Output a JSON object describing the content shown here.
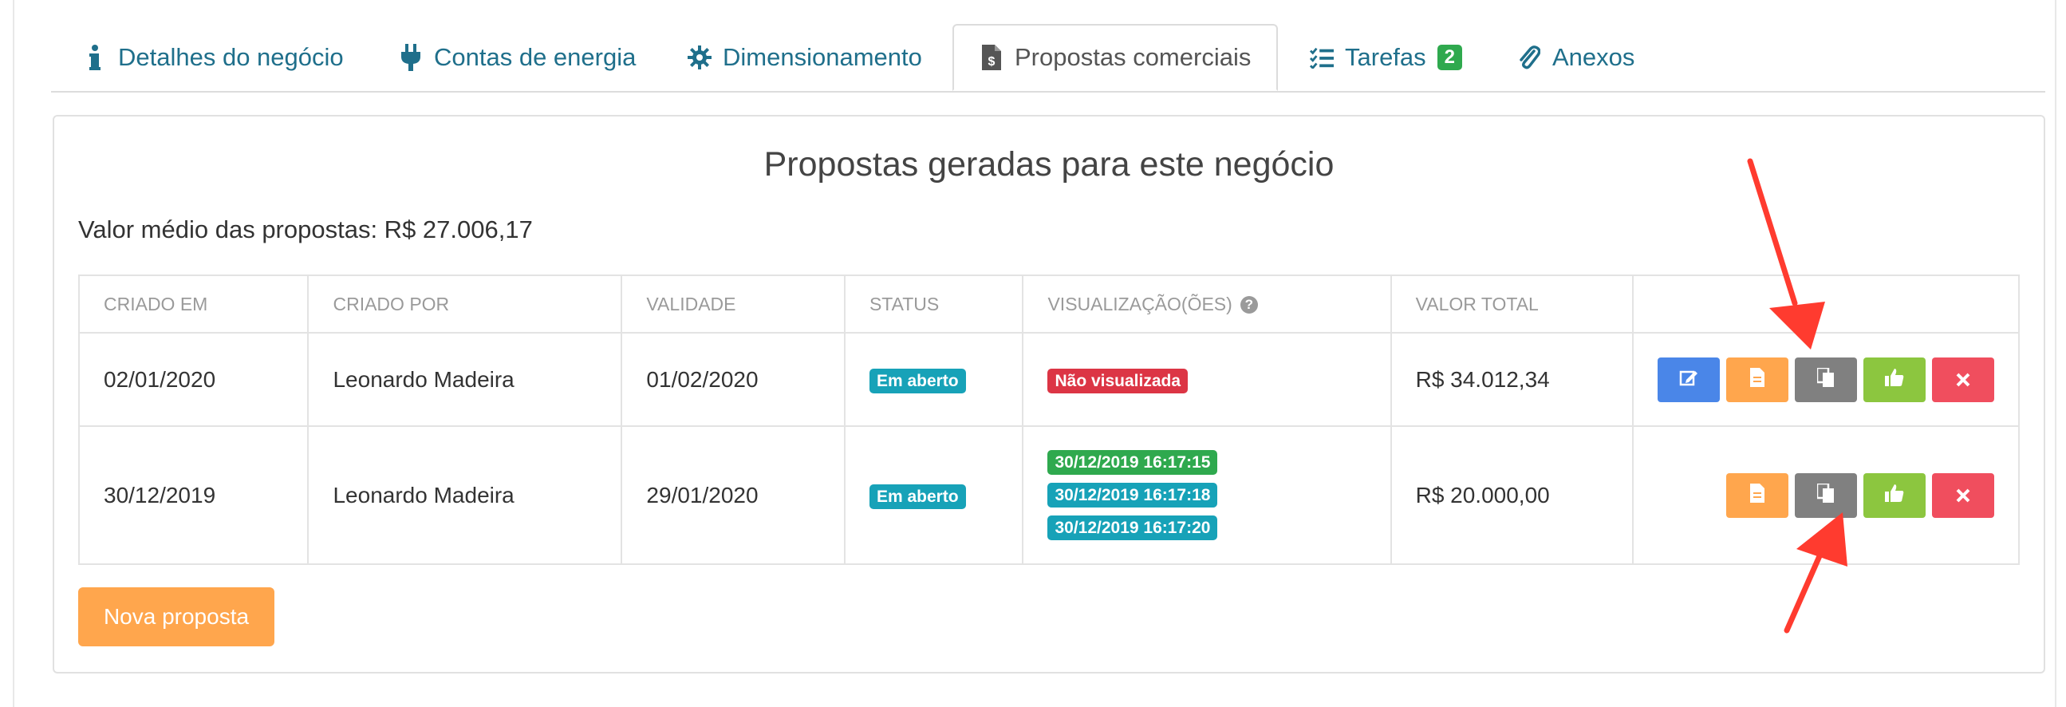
{
  "tabs": [
    {
      "label": "Detalhes do negócio",
      "icon": "info-icon"
    },
    {
      "label": "Contas de energia",
      "icon": "plug-icon"
    },
    {
      "label": "Dimensionamento",
      "icon": "gear-icon"
    },
    {
      "label": "Propostas comerciais",
      "icon": "invoice-icon",
      "active": true
    },
    {
      "label": "Tarefas",
      "icon": "task-list-icon",
      "badge": "2"
    },
    {
      "label": "Anexos",
      "icon": "paperclip-icon"
    }
  ],
  "panel": {
    "title": "Propostas geradas para este negócio",
    "average": "Valor médio das propostas: R$ 27.006,17"
  },
  "table": {
    "headers": [
      "CRIADO EM",
      "CRIADO POR",
      "VALIDADE",
      "STATUS",
      "VISUALIZAÇÃO(ÕES)",
      "VALOR TOTAL"
    ],
    "rows": [
      {
        "created": "02/01/2020",
        "author": "Leonardo Madeira",
        "validity": "01/02/2020",
        "status": "Em aberto",
        "views": [
          "Não visualizada"
        ],
        "total": "R$ 34.012,34"
      },
      {
        "created": "30/12/2019",
        "author": "Leonardo Madeira",
        "validity": "29/01/2020",
        "status": "Em aberto",
        "views": [
          "30/12/2019 16:17:15",
          "30/12/2019 16:17:18",
          "30/12/2019 16:17:20"
        ],
        "total": "R$ 20.000,00"
      }
    ]
  },
  "new_button": "Nova proposta",
  "colors": {
    "tab_text": "#1f6f8b",
    "edit": "#4a86e8",
    "document": "#ffa64d",
    "copy": "#808080",
    "approve": "#8cc63f",
    "delete": "#f04e5e",
    "annotation_arrow": "#ff3b2f"
  }
}
